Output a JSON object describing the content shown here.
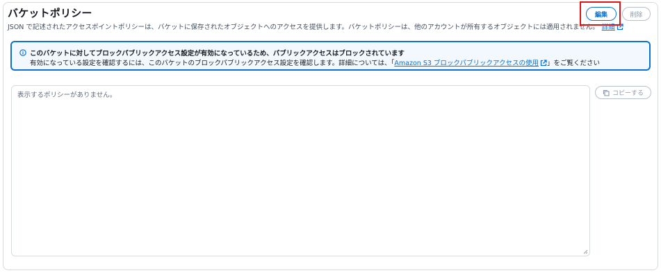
{
  "header": {
    "title": "バケットポリシー",
    "description": "JSON で記述されたアクセスポイントポリシーは、バケットに保存されたオブジェクトへのアクセスを提供します。バケットポリシーは、他のアカウントが所有するオブジェクトには適用されません。",
    "learn_more_label": "詳細"
  },
  "actions": {
    "edit_label": "編集",
    "delete_label": "削除",
    "copy_label": "コピーする"
  },
  "alert": {
    "title": "このバケットに対してブロックパブリックアクセス設定が有効になっているため、パブリックアクセスはブロックされています",
    "body_prefix": "有効になっている設定を確認するには、このバケットのブロックパブリックアクセス設定を確認します。詳細については、「",
    "link_label": "Amazon S3 ブロックパブリックアクセスの使用",
    "body_suffix": "」をご覧ください"
  },
  "policy_editor": {
    "placeholder": "表示するポリシーがありません。"
  },
  "colors": {
    "accent": "#0972d3",
    "highlight_box": "#d91515",
    "alert_background": "#f2f8fd"
  },
  "icons": [
    "external-link-icon",
    "info-icon",
    "copy-icon",
    "resize-handle-icon"
  ]
}
